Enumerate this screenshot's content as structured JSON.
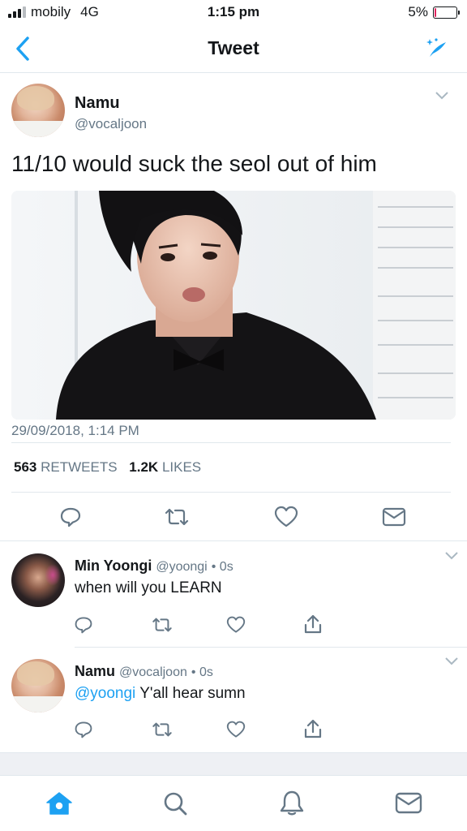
{
  "status_bar": {
    "carrier": "mobily",
    "network": "4G",
    "time": "1:15 pm",
    "battery_percent": "5%",
    "battery_level": 0.05,
    "battery_color": "#e0245e"
  },
  "nav": {
    "title": "Tweet",
    "back_icon": "chevron-left-icon",
    "compose_icon": "sparkle-compose-icon",
    "accent_color": "#1da1f2"
  },
  "tweet": {
    "author_name": "Namu",
    "author_handle": "@vocaljoon",
    "text": "11/10 would suck the seol out of him",
    "timestamp": "29/09/2018, 1:14 PM",
    "retweet_count": "563",
    "retweet_label": "RETWEETS",
    "like_count": "1.2K",
    "like_label": "LIKES",
    "actions": [
      "reply-icon",
      "retweet-icon",
      "like-icon",
      "message-icon"
    ]
  },
  "replies": [
    {
      "author_name": "Min Yoongi",
      "author_handle": "@yoongi",
      "age": "• 0s",
      "mention": "",
      "text": "when will you LEARN",
      "actions": [
        "reply-icon",
        "retweet-icon",
        "like-icon",
        "share-icon"
      ]
    },
    {
      "author_name": "Namu",
      "author_handle": "@vocaljoon",
      "age": "• 0s",
      "mention": "@yoongi",
      "text": "Y'all hear sumn",
      "actions": [
        "reply-icon",
        "retweet-icon",
        "like-icon",
        "share-icon"
      ]
    }
  ],
  "tab_bar": {
    "tabs": [
      "home-icon",
      "search-icon",
      "notifications-icon",
      "messages-icon"
    ],
    "active": "home-icon"
  }
}
